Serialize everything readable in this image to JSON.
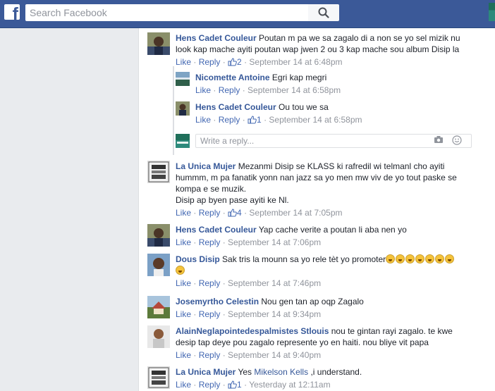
{
  "header": {
    "logo": "f",
    "search_placeholder": "Search Facebook"
  },
  "colors": {
    "topbar": "#3b5998",
    "link": "#365899",
    "meta_gray": "#90949c"
  },
  "comments": [
    {
      "author": "Hens Cadet Couleur",
      "text_line1": "Poutan m pa we sa zagalo di a non se yo sel mizik nu",
      "text_line2": "look kap mache ayiti poutan wap jwen 2 ou 3 kap mache sou album Disip la",
      "like": "Like",
      "reply": "Reply",
      "likes": "2",
      "timestamp": "September 14 at 6:48pm"
    },
    {
      "author": "Nicomette Antoine",
      "text": "Egri kap megri",
      "like": "Like",
      "reply": "Reply",
      "timestamp": "September 14 at 6:58pm"
    },
    {
      "author": "Hens Cadet Couleur",
      "text": "Ou tou we sa",
      "like": "Like",
      "reply": "Reply",
      "likes": "1",
      "timestamp": "September 14 at 6:58pm"
    },
    {
      "author": "La Unica Mujer",
      "text_line1": "Mezanmi Disip se KLASS ki rafredil wi telmanl cho ayiti",
      "text_line2": "hummm, m pa fanatik yonn nan jazz sa yo men mw viv de yo tout paske se",
      "text_line3": "kompa e se muzik.",
      "text_line4": "Disip ap byen pase ayiti ke Nl.",
      "like": "Like",
      "reply": "Reply",
      "likes": "4",
      "timestamp": "September 14 at 7:05pm"
    },
    {
      "author": "Hens Cadet Couleur",
      "text": "Yap cache verite a poutan li aba nen yo",
      "like": "Like",
      "reply": "Reply",
      "timestamp": "September 14 at 7:06pm"
    },
    {
      "author": "Dous Disip",
      "text": "Sak tris la mounn sa yo rele tèt yo promoter",
      "like": "Like",
      "reply": "Reply",
      "timestamp": "September 14 at 7:46pm"
    },
    {
      "author": "Josemyrtho Celestin",
      "text": "Nou gen tan ap oqp Zagalo",
      "like": "Like",
      "reply": "Reply",
      "timestamp": "September 14 at 9:34pm"
    },
    {
      "author": "AlainNeglapointedespalmistes Stlouis",
      "text_line1": "nou te gintan rayi zagalo. te kwe",
      "text_line2": "desip tap deye pou zagalo represente yo en haiti. nou bliye vit papa",
      "like": "Like",
      "reply": "Reply",
      "timestamp": "September 14 at 9:40pm"
    },
    {
      "author": "La Unica Mujer",
      "text_pre": "Yes",
      "mention": "Mikelson Kells",
      "text_post": ",i understand.",
      "like": "Like",
      "reply": "Reply",
      "likes": "1",
      "timestamp": "Yesterday at 12:11am"
    }
  ],
  "reply_box": {
    "placeholder": "Write a reply..."
  }
}
